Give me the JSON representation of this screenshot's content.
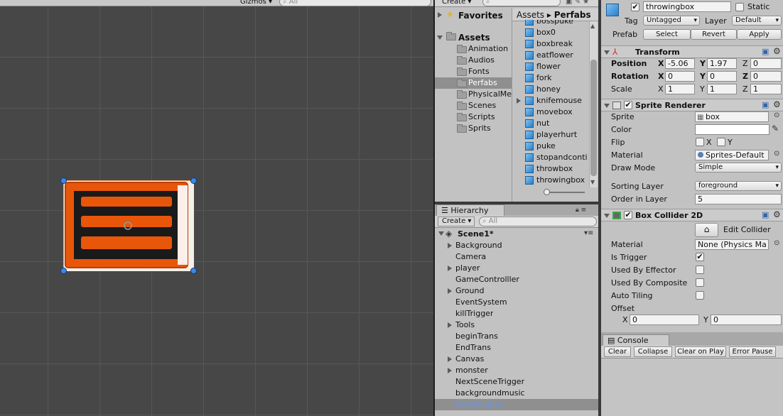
{
  "scene": {
    "gizmos_label": "Gizmos",
    "search_placeholder": "All"
  },
  "project": {
    "create_label": "Create",
    "favorites_label": "Favorites",
    "assets_label": "Assets",
    "folders": [
      "Animation",
      "Audios",
      "Fonts",
      "Perfabs",
      "PhysicalMe",
      "Scenes",
      "Scripts",
      "Sprits"
    ],
    "selected_folder": "Perfabs",
    "breadcrumb": [
      "Assets",
      "Perfabs"
    ],
    "items": [
      "bosspuke",
      "box0",
      "boxbreak",
      "eatflower",
      "flower",
      "fork",
      "honey",
      "knifemouse",
      "movebox",
      "nut",
      "playerhurt",
      "puke",
      "stopandconti",
      "throwbox",
      "throwingbox"
    ]
  },
  "hierarchy": {
    "tab_label": "Hierarchy",
    "create_label": "Create",
    "search_placeholder": "All",
    "scene_name": "Scene1*",
    "items": [
      {
        "label": "Background",
        "expandable": true
      },
      {
        "label": "Camera",
        "expandable": false
      },
      {
        "label": "player",
        "expandable": true
      },
      {
        "label": "GameControlller",
        "expandable": false
      },
      {
        "label": "Ground",
        "expandable": true
      },
      {
        "label": "EventSystem",
        "expandable": false
      },
      {
        "label": "killTrigger",
        "expandable": false
      },
      {
        "label": "Tools",
        "expandable": true
      },
      {
        "label": "beginTrans",
        "expandable": false
      },
      {
        "label": "EndTrans",
        "expandable": false
      },
      {
        "label": "Canvas",
        "expandable": true
      },
      {
        "label": "monster",
        "expandable": true
      },
      {
        "label": "NextSceneTrigger",
        "expandable": false
      },
      {
        "label": "backgroundmusic",
        "expandable": false
      },
      {
        "label": "throwingbox",
        "expandable": false
      }
    ]
  },
  "inspector": {
    "object_name": "throwingbox",
    "static_label": "Static",
    "tag_label": "Tag",
    "tag_value": "Untagged",
    "layer_label": "Layer",
    "layer_value": "Default",
    "prefab_label": "Prefab",
    "prefab_select": "Select",
    "prefab_revert": "Revert",
    "prefab_apply": "Apply",
    "transform": {
      "title": "Transform",
      "position_label": "Position",
      "rotation_label": "Rotation",
      "scale_label": "Scale",
      "x_label": "X",
      "y_label": "Y",
      "z_label": "Z",
      "position": {
        "x": "-5.06",
        "y": "1.97",
        "z": "0"
      },
      "rotation": {
        "x": "0",
        "y": "0",
        "z": "0"
      },
      "scale": {
        "x": "1",
        "y": "1",
        "z": "1"
      }
    },
    "sprite_renderer": {
      "title": "Sprite Renderer",
      "sprite_label": "Sprite",
      "sprite_value": "box",
      "color_label": "Color",
      "color_value": "#ffffff",
      "flip_label": "Flip",
      "flip_x": "X",
      "flip_y": "Y",
      "material_label": "Material",
      "material_value": "Sprites-Default",
      "draw_mode_label": "Draw Mode",
      "draw_mode_value": "Simple",
      "sorting_layer_label": "Sorting Layer",
      "sorting_layer_value": "foreground",
      "order_label": "Order in Layer",
      "order_value": "5"
    },
    "box_collider": {
      "title": "Box Collider 2D",
      "edit_collider_label": "Edit Collider",
      "material_label": "Material",
      "material_value": "None (Physics Ma",
      "is_trigger_label": "Is Trigger",
      "is_trigger": true,
      "used_by_effector_label": "Used By Effector",
      "used_by_composite_label": "Used By Composite",
      "auto_tiling_label": "Auto Tiling",
      "offset_label": "Offset",
      "offset_x_label": "X",
      "offset_x": "0",
      "offset_y_label": "Y",
      "offset_y": "0"
    }
  },
  "console": {
    "tab_label": "Console",
    "clear": "Clear",
    "collapse": "Collapse",
    "clear_on_play": "Clear on Play",
    "error_pause": "Error Pause"
  },
  "colors": {
    "selection_text": "#6a95e8",
    "selection_bg": "#8f8f8f",
    "sprite_orange": "#e8560a"
  }
}
